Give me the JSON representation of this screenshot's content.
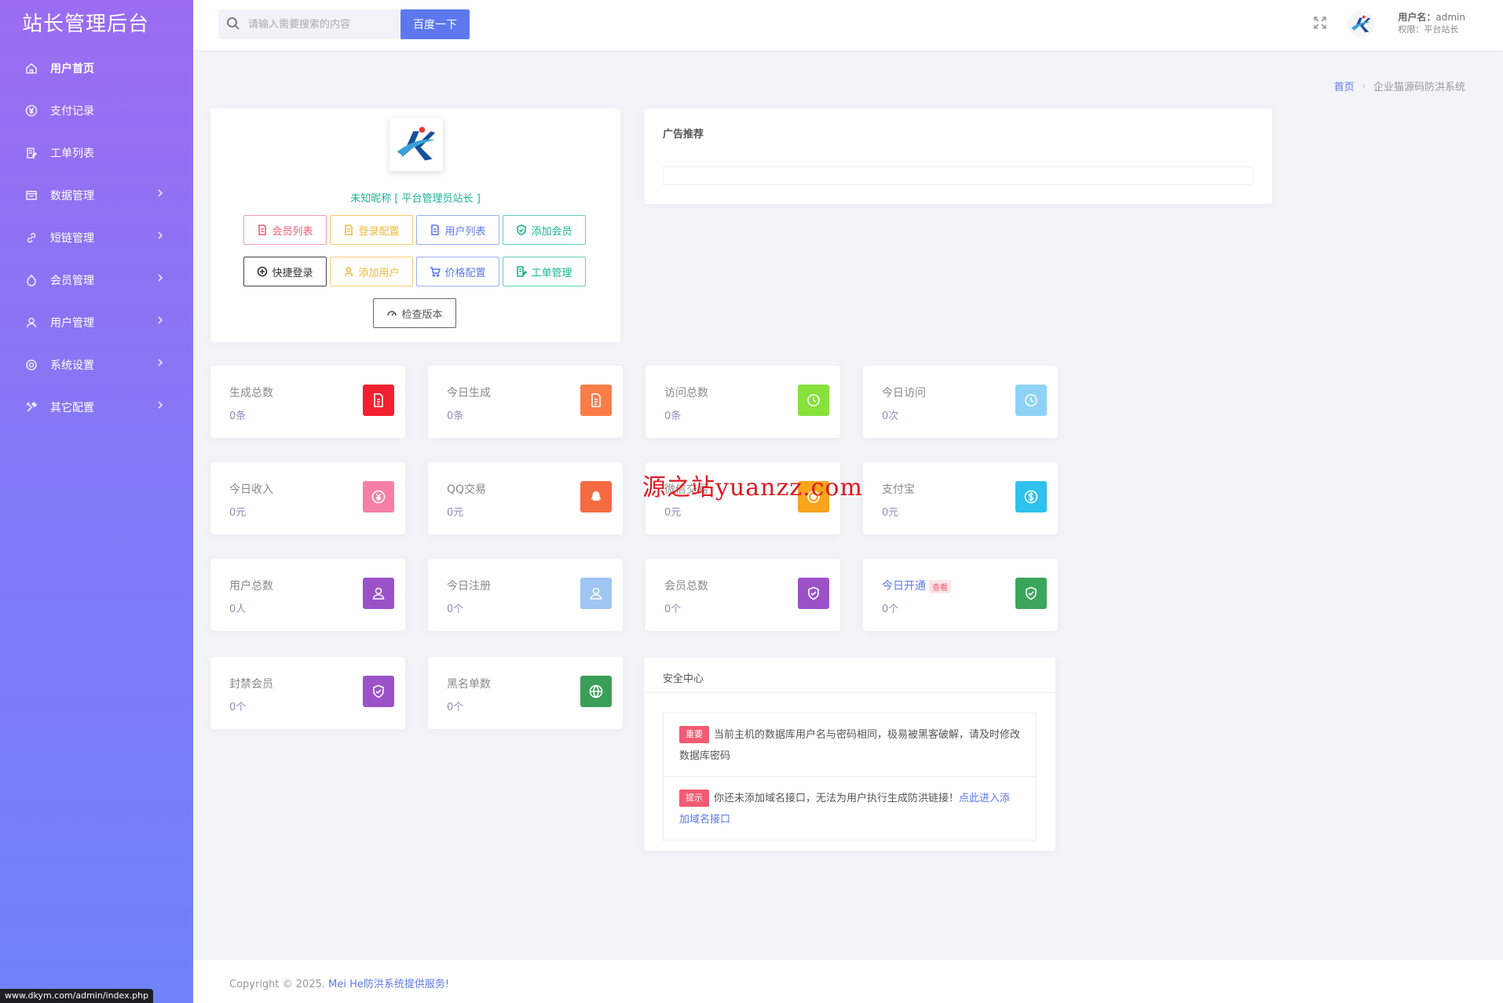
{
  "brand": {
    "title": "站长管理后台"
  },
  "sidebar": {
    "items": [
      {
        "label": "用户首页",
        "icon": "home-icon"
      },
      {
        "label": "支付记录",
        "icon": "yen-icon"
      },
      {
        "label": "工单列表",
        "icon": "ticket-icon"
      },
      {
        "label": "数据管理",
        "icon": "database-icon"
      },
      {
        "label": "短链管理",
        "icon": "link-icon"
      },
      {
        "label": "会员管理",
        "icon": "member-icon"
      },
      {
        "label": "用户管理",
        "icon": "user-icon"
      },
      {
        "label": "系统设置",
        "icon": "gear-icon"
      },
      {
        "label": "其它配置",
        "icon": "tools-icon"
      }
    ]
  },
  "search": {
    "placeholder": "请输入需要搜索的内容",
    "button": "百度一下"
  },
  "user": {
    "name_label": "用户名：",
    "name": "admin",
    "role": "权限：平台站长"
  },
  "breadcrumb": {
    "home": "首页",
    "current": "企业猫源码防洪系统"
  },
  "profile": {
    "nickname": "未知昵称 [ 平台管理员站长 ]",
    "buttons": [
      {
        "label": "会员列表",
        "icon": "doc-icon",
        "color": "#f15b73"
      },
      {
        "label": "登录配置",
        "icon": "doc-icon",
        "color": "#f5b83b"
      },
      {
        "label": "用户列表",
        "icon": "doc-icon",
        "color": "#5d78ef"
      },
      {
        "label": "添加会员",
        "icon": "shield-icon",
        "color": "#19b394"
      },
      {
        "label": "快捷登录",
        "icon": "plus-circle-icon",
        "color": "#333333"
      },
      {
        "label": "添加用户",
        "icon": "user-icon",
        "color": "#f5b83b"
      },
      {
        "label": "价格配置",
        "icon": "cart-icon",
        "color": "#5d78ef"
      },
      {
        "label": "工单管理",
        "icon": "ticket-icon",
        "color": "#19b394"
      }
    ],
    "check_version": "检查版本"
  },
  "ad": {
    "title": "广告推荐"
  },
  "stats": [
    {
      "label": "生成总数",
      "value": "0条",
      "color": "#f3212f",
      "icon": "doc-icon"
    },
    {
      "label": "今日生成",
      "value": "0条",
      "color": "#fa7d47",
      "icon": "doc-icon"
    },
    {
      "label": "访问总数",
      "value": "0条",
      "color": "#86e23a",
      "icon": "clock-icon"
    },
    {
      "label": "今日访问",
      "value": "0次",
      "color": "#8ed3f6",
      "icon": "clock-icon"
    },
    {
      "label": "今日收入",
      "value": "0元",
      "color": "#f77fa6",
      "icon": "yen-icon"
    },
    {
      "label": "QQ交易",
      "value": "0元",
      "color": "#f56b41",
      "icon": "qq-icon"
    },
    {
      "label": "微信交易",
      "value": "0元",
      "color": "#f8a51d",
      "icon": "wechat-icon"
    },
    {
      "label": "支付宝",
      "value": "0元",
      "color": "#2fc1ef",
      "icon": "alipay-icon"
    },
    {
      "label": "用户总数",
      "value": "0人",
      "color": "#9b52c9",
      "icon": "user-icon"
    },
    {
      "label": "今日注册",
      "value": "0个",
      "color": "#9fc5f3",
      "icon": "user-icon"
    },
    {
      "label": "会员总数",
      "value": "0个",
      "color": "#9b52c9",
      "icon": "shield-icon"
    },
    {
      "label": "今日开通",
      "value": "0个",
      "color": "#3aa55b",
      "icon": "shield-icon",
      "badge": "查看"
    },
    {
      "label": "封禁会员",
      "value": "0个",
      "color": "#9b52c9",
      "icon": "shield-icon"
    },
    {
      "label": "黑名单数",
      "value": "0个",
      "color": "#3a9e57",
      "icon": "globe-icon"
    }
  ],
  "security": {
    "title": "安全中心",
    "items": [
      {
        "tag": "重要",
        "text": "当前主机的数据库用户名与密码相同，极易被黑客破解，请及时修改数据库密码",
        "link": ""
      },
      {
        "tag": "提示",
        "text": "你还未添加域名接口，无法为用户执行生成防洪链接！",
        "link": "点此进入添加域名接口"
      }
    ]
  },
  "footer": {
    "prefix": "Copyright © 2025. ",
    "link": "Mei He防洪系统提供服务!"
  },
  "status_url": "www.dkym.com/admin/index.php",
  "watermark": "源之站yuanzz.com"
}
